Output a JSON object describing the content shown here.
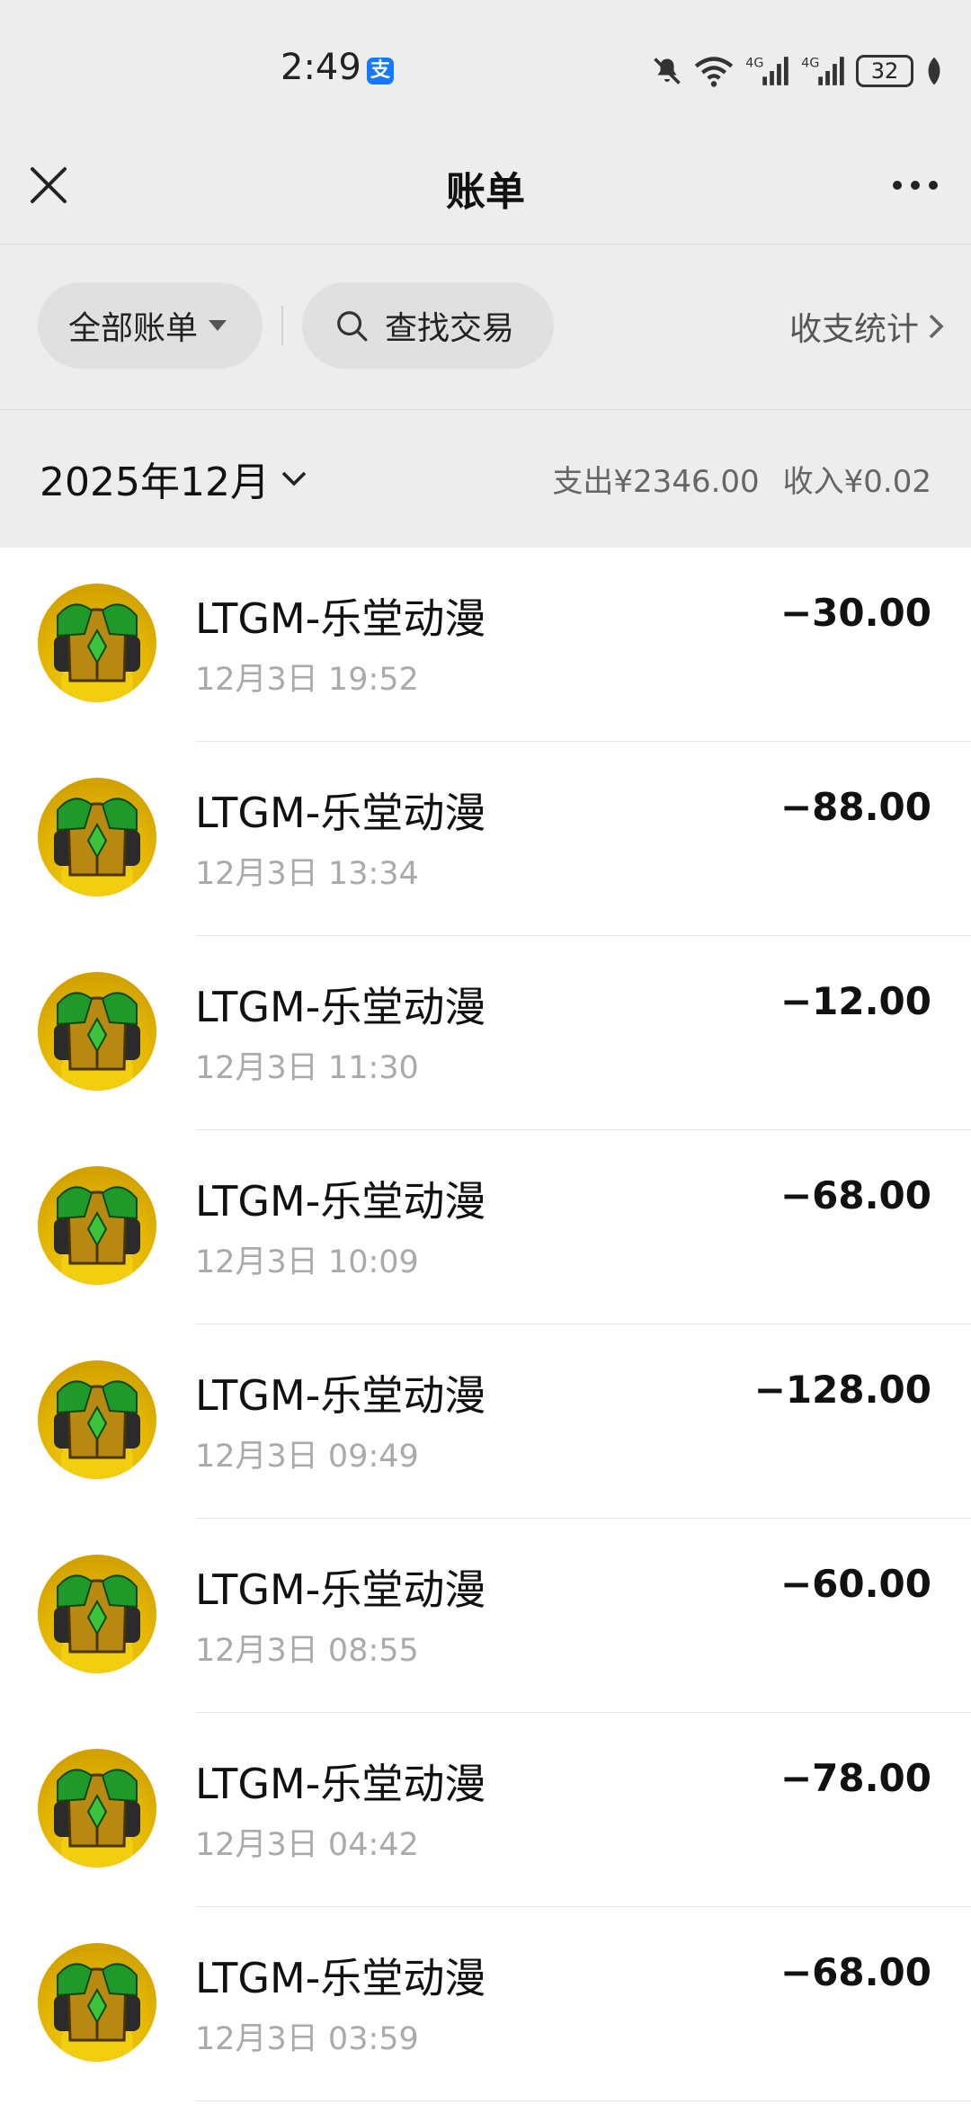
{
  "status": {
    "time": "2:49",
    "app_badge": "支",
    "battery": "32",
    "net1": "4G",
    "net2": "4G"
  },
  "nav": {
    "title": "账单"
  },
  "filters": {
    "all_bills": "全部账单",
    "search": "查找交易",
    "stats": "收支统计"
  },
  "month": {
    "label": "2025年12月",
    "expense": "支出¥2346.00",
    "income": "收入¥0.02"
  },
  "transactions": [
    {
      "name": "LTGM-乐堂动漫",
      "time": "12月3日 19:52",
      "amount": "−30.00"
    },
    {
      "name": "LTGM-乐堂动漫",
      "time": "12月3日 13:34",
      "amount": "−88.00"
    },
    {
      "name": "LTGM-乐堂动漫",
      "time": "12月3日 11:30",
      "amount": "−12.00"
    },
    {
      "name": "LTGM-乐堂动漫",
      "time": "12月3日 10:09",
      "amount": "−68.00"
    },
    {
      "name": "LTGM-乐堂动漫",
      "time": "12月3日 09:49",
      "amount": "−128.00"
    },
    {
      "name": "LTGM-乐堂动漫",
      "time": "12月3日 08:55",
      "amount": "−60.00"
    },
    {
      "name": "LTGM-乐堂动漫",
      "time": "12月3日 04:42",
      "amount": "−78.00"
    },
    {
      "name": "LTGM-乐堂动漫",
      "time": "12月3日 03:59",
      "amount": "−68.00"
    }
  ],
  "colors": {
    "header_bg": "#ededed",
    "pill_bg": "#e0e0e0",
    "avatar_gold": "#e6b800",
    "avatar_green": "#1f9a2a",
    "badge_blue": "#1677ff"
  },
  "icons": {
    "close": "close-icon",
    "more": "more-icon",
    "search": "search-icon",
    "chevron": "chevron-right-icon",
    "month_dropdown": "chevron-down-icon"
  }
}
